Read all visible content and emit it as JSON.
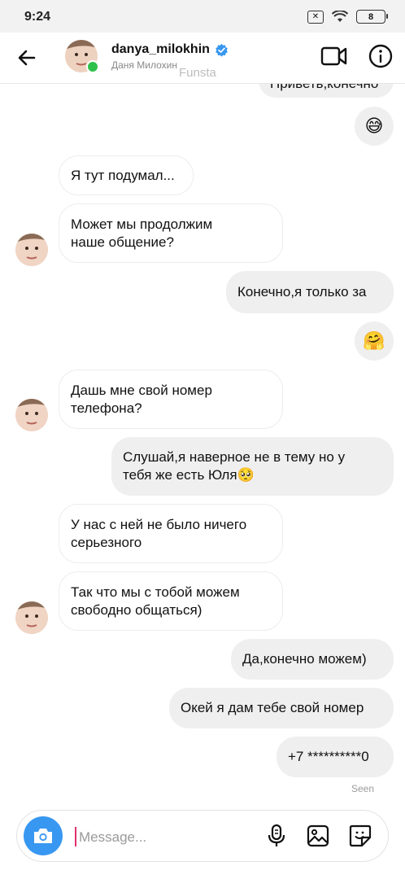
{
  "status_bar": {
    "time": "9:24",
    "battery": "8"
  },
  "header": {
    "username": "danya_milokhin",
    "subtitle": "Даня Милохин",
    "watermark": "Funsta"
  },
  "messages": [
    {
      "dir": "out",
      "text": "Приветь,конечно",
      "partial": true
    },
    {
      "dir": "out",
      "text": "😅"
    },
    {
      "dir": "in",
      "text": "Я тут подумал..."
    },
    {
      "dir": "in",
      "text": "Может мы продолжим наше общение?"
    },
    {
      "dir": "out",
      "text": "Конечно,я только за"
    },
    {
      "dir": "out",
      "text": "🤗"
    },
    {
      "dir": "in",
      "text": "Дашь мне свой номер телефона?"
    },
    {
      "dir": "out",
      "text": "Слушай,я наверное не в тему но у тебя же есть Юля🥺"
    },
    {
      "dir": "in",
      "text": "У нас с ней не было ничего серьезного"
    },
    {
      "dir": "in",
      "text": "Так что мы с тобой можем свободно общаться)"
    },
    {
      "dir": "out",
      "text": "Да,конечно можем)"
    },
    {
      "dir": "out",
      "text": "Окей я дам тебе свой номер"
    },
    {
      "dir": "out",
      "text": "+7 **********0"
    }
  ],
  "seen_label": "Seen",
  "composer": {
    "placeholder": "Message..."
  }
}
